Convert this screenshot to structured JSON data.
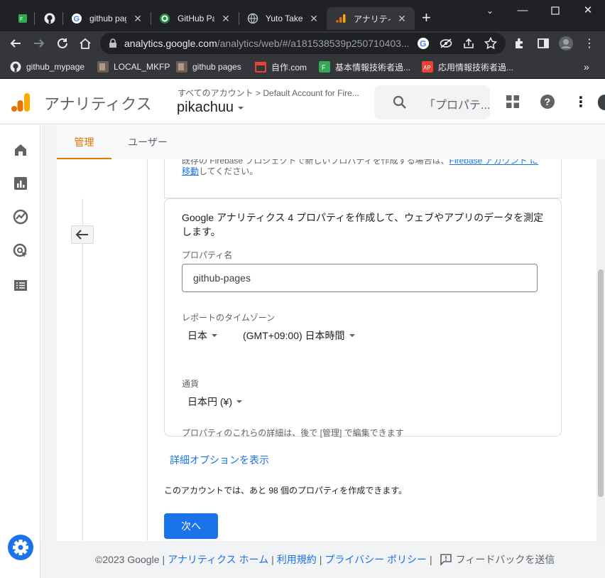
{
  "browser": {
    "tabs": [
      {
        "title": ""
      },
      {
        "title": ""
      },
      {
        "title": "github pag"
      },
      {
        "title": "GitHub Pag"
      },
      {
        "title": "Yuto Takeb"
      },
      {
        "title": "アナリティクス"
      }
    ],
    "new_tab": "+",
    "url_host": "analytics.google.com",
    "url_path": "/analytics/web/#/a181538539p250710403...",
    "bookmarks": [
      {
        "label": "github_mypage"
      },
      {
        "label": "LOCAL_MKFP"
      },
      {
        "label": "github pages"
      },
      {
        "label": "自作.com"
      },
      {
        "label": "基本情報技術者過..."
      },
      {
        "label": "応用情報技術者過..."
      }
    ],
    "more_bookmarks": "»"
  },
  "header": {
    "app_name": "アナリティクス",
    "breadcrumb_root": "すべてのアカウント",
    "breadcrumb_sep": ">",
    "breadcrumb_account": "Default Account for Fire...",
    "property": "pikachuu",
    "search_placeholder": "「プロパテ..."
  },
  "tabs": {
    "admin": "管理",
    "user": "ユーザー"
  },
  "form": {
    "firebase_note_prefix": "既存の Firebase プロジェクトで新しいプロパティを作成する場合は、",
    "firebase_link": "Firebase アカウント に移動",
    "firebase_note_suffix": "してください。",
    "intro": "Google アナリティクス 4 プロパティを作成して、ウェブやアプリのデータを測定します。",
    "property_name_label": "プロパティ名",
    "property_name_value": "github-pages",
    "timezone_label": "レポートのタイムゾーン",
    "country": "日本",
    "timezone": "(GMT+09:00) 日本時間",
    "currency_label": "通貨",
    "currency": "日本円 (¥)",
    "edit_note": "プロパティのこれらの詳細は、後で [管理] で編集できます",
    "advanced_link": "詳細オプションを表示",
    "remaining": "このアカウントでは、あと 98 個のプロパティを作成できます。",
    "next_button": "次へ"
  },
  "footer": {
    "copyright": "©2023 Google",
    "sep": "|",
    "home": "アナリティクス ホーム",
    "terms": "利用規約",
    "privacy": "プライバシー ポリシー",
    "feedback": "フィードバックを送信"
  },
  "colors": {
    "accent": "#1a73e8",
    "ga_orange": "#f9ab00",
    "ga_dark_orange": "#e37400",
    "tab_text_active": "#e37400"
  }
}
